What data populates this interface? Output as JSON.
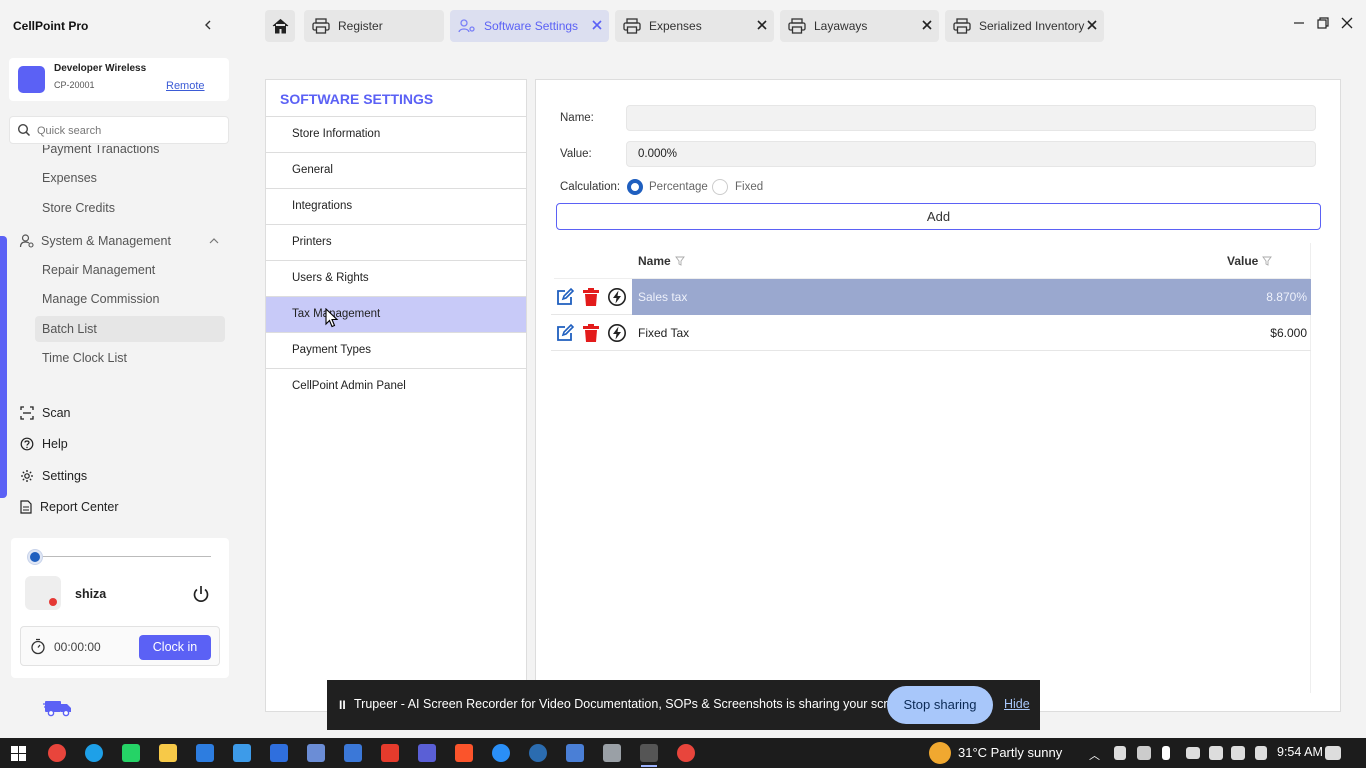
{
  "app": {
    "title": "CellPoint Pro"
  },
  "store": {
    "name": "Developer Wireless",
    "id": "CP-20001",
    "remote_label": "Remote"
  },
  "search": {
    "placeholder": "Quick search"
  },
  "sidebar": {
    "sub_items_top": [
      "Payment Tranactions",
      "Expenses",
      "Store Credits"
    ],
    "group": {
      "label": "System & Management"
    },
    "group_items": [
      "Repair Management",
      "Manage Commission",
      "Batch List",
      "Time Clock List"
    ],
    "main_items": [
      {
        "label": "Scan",
        "icon": "scan-icon"
      },
      {
        "label": "Help",
        "icon": "help-icon"
      },
      {
        "label": "Settings",
        "icon": "gear-icon"
      },
      {
        "label": "Report Center",
        "icon": "report-icon"
      }
    ]
  },
  "user": {
    "name": "shiza",
    "timer": "00:00:00",
    "clock_in_label": "Clock in"
  },
  "tabs": [
    {
      "label": "Register",
      "icon": "printer-icon",
      "active": false
    },
    {
      "label": "Software Settings",
      "icon": "settings-icon",
      "active": true
    },
    {
      "label": "Expenses",
      "icon": "printer-icon",
      "active": false
    },
    {
      "label": "Layaways",
      "icon": "printer-icon",
      "active": false
    },
    {
      "label": "Serialized Inventory",
      "icon": "printer-icon",
      "active": false
    }
  ],
  "settings_menu": {
    "title": "SOFTWARE SETTINGS",
    "items": [
      "Store Information",
      "General",
      "Integrations",
      "Printers",
      "Users & Rights",
      "Tax Management",
      "Payment Types",
      "CellPoint Admin Panel"
    ],
    "selected": "Tax Management"
  },
  "tax_form": {
    "name_label": "Name:",
    "name_value": "",
    "value_label": "Value:",
    "value_value": "0.000%",
    "calc_label": "Calculation:",
    "calc_options": [
      "Percentage",
      "Fixed"
    ],
    "calc_selected": "Percentage",
    "add_label": "Add"
  },
  "tax_table": {
    "columns": [
      "Name",
      "Value"
    ],
    "rows": [
      {
        "name": "Sales tax",
        "value": "8.870%",
        "selected": true
      },
      {
        "name": "Fixed Tax",
        "value": "$6.000",
        "selected": false
      }
    ]
  },
  "screen_share": {
    "message": "Trupeer - AI Screen Recorder for Video Documentation, SOPs & Screenshots is sharing your screen.",
    "stop_label": "Stop sharing",
    "hide_label": "Hide"
  },
  "taskbar": {
    "weather": "31°C  Partly sunny",
    "time": "9:54 AM"
  },
  "colors": {
    "accent": "#5b61f5",
    "selected_row": "#9aa8cf",
    "selected_menu": "#c8caf8",
    "delete": "#e31b1b",
    "edit": "#1f5fbf"
  }
}
